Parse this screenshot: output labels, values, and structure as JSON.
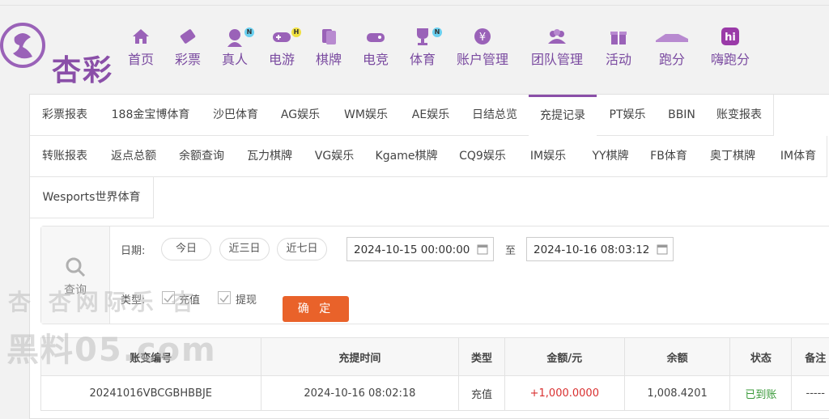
{
  "brand": {
    "name": "杏彩"
  },
  "nav": [
    {
      "label": "首页",
      "icon": "home-icon"
    },
    {
      "label": "彩票",
      "icon": "lottery-ticket-icon"
    },
    {
      "label": "真人",
      "icon": "live-dealer-icon",
      "badge": "N",
      "badge_color": "#6ad0f0"
    },
    {
      "label": "电游",
      "icon": "gamepad-icon",
      "badge": "H",
      "badge_color": "#f0e040"
    },
    {
      "label": "棋牌",
      "icon": "cards-icon"
    },
    {
      "label": "电竞",
      "icon": "esports-icon"
    },
    {
      "label": "体育",
      "icon": "trophy-icon",
      "badge": "N",
      "badge_color": "#6ad0f0"
    },
    {
      "label": "账户管理",
      "icon": "account-icon"
    },
    {
      "label": "团队管理",
      "icon": "team-icon"
    },
    {
      "label": "活动",
      "icon": "gift-icon"
    },
    {
      "label": "跑分",
      "icon": "running-icon"
    },
    {
      "label": "嗨跑分",
      "icon": "hi-app-icon"
    }
  ],
  "tabs": {
    "row1": [
      "彩票报表",
      "188金宝博体育",
      "沙巴体育",
      "AG娱乐",
      "WM娱乐",
      "AE娱乐",
      "日结总览",
      "充提记录",
      "PT娱乐",
      "BBIN",
      "账变报表"
    ],
    "row2": [
      "转账报表",
      "返点总额",
      "余额查询",
      "瓦力棋牌",
      "VG娱乐",
      "Kgame棋牌",
      "CQ9娱乐",
      "IM娱乐",
      "YY棋牌",
      "FB体育",
      "奥丁棋牌",
      "IM体育"
    ],
    "row3": [
      "Wesports世界体育"
    ],
    "active": "充提记录"
  },
  "filter": {
    "search_label": "查询",
    "date_label": "日期:",
    "quick_dates": [
      "今日",
      "近三日",
      "近七日"
    ],
    "start": "2024-10-15 00:00:00",
    "to_label": "至",
    "end": "2024-10-16 08:03:12",
    "type_label": "类型:",
    "type_deposit": "充值",
    "type_withdraw": "提现",
    "confirm": "确 定"
  },
  "table": {
    "headers": [
      "账变编号",
      "充提时间",
      "类型",
      "金额/元",
      "余额",
      "状态",
      "备注"
    ],
    "rows": [
      [
        "20241016VBCGBHBBJE",
        "2024-10-16 08:02:18",
        "充值",
        "+1,000.0000",
        "1,008.4201",
        "已到账",
        "-----"
      ]
    ]
  },
  "watermark": {
    "line1": "杏 杏网际乐 杏",
    "line2": "黑料05.com"
  },
  "colors": {
    "brand": "#8a4fa8",
    "confirm": "#e9622a",
    "positive": "#d93030",
    "success": "#3a9a3a"
  }
}
